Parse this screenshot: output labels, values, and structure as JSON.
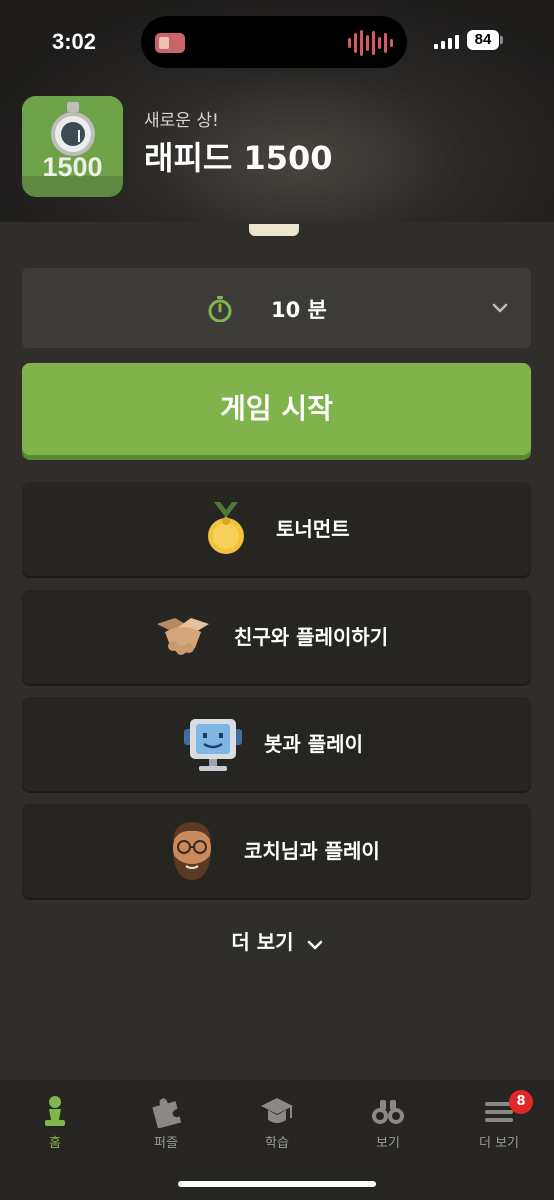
{
  "status_bar": {
    "time": "3:02",
    "battery": "84"
  },
  "award": {
    "subtitle": "새로운 상!",
    "title": "래피드 1500",
    "badge_number": "1500",
    "badge_color": "#6fa34a"
  },
  "time_control": {
    "value": "10 분",
    "icon": "stopwatch-icon",
    "accent": "#81b64c"
  },
  "start_button": {
    "label": "게임 시작",
    "color": "#80b34b"
  },
  "menu": [
    {
      "label": "토너먼트",
      "icon": "medal-icon"
    },
    {
      "label": "친구와 플레이하기",
      "icon": "handshake-icon"
    },
    {
      "label": "봇과 플레이",
      "icon": "robot-computer-icon"
    },
    {
      "label": "코치님과 플레이",
      "icon": "coach-avatar-icon"
    }
  ],
  "more": {
    "label": "더 보기"
  },
  "bottom_nav": [
    {
      "label": "홈",
      "icon": "pawn-icon",
      "active": true
    },
    {
      "label": "퍼즐",
      "icon": "puzzle-icon"
    },
    {
      "label": "학습",
      "icon": "graduation-cap-icon"
    },
    {
      "label": "보기",
      "icon": "binoculars-icon"
    },
    {
      "label": "더 보기",
      "icon": "menu-icon",
      "badge": "8"
    }
  ]
}
